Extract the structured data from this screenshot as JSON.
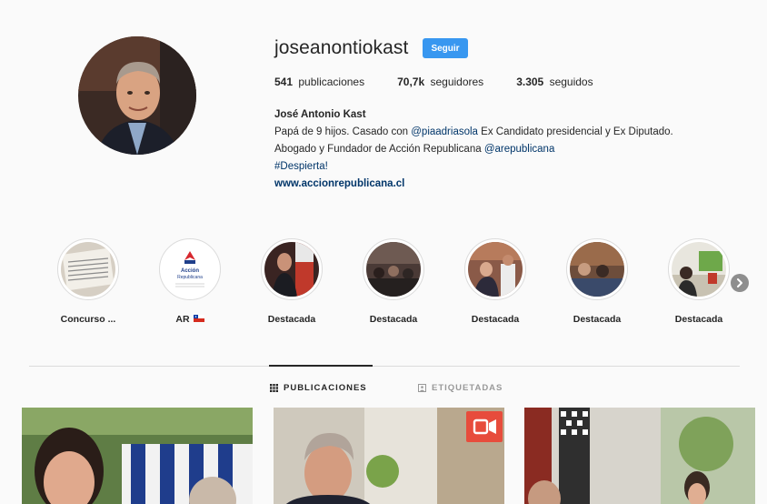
{
  "profile": {
    "username": "joseanontiokast",
    "follow_label": "Seguir",
    "stats": {
      "posts_count": "541",
      "posts_label": "publicaciones",
      "followers_count": "70,7k",
      "followers_label": "seguidores",
      "following_count": "3.305",
      "following_label": "seguidos"
    },
    "full_name": "José Antonio Kast",
    "bio_part1": "Papá de 9 hijos. Casado con ",
    "bio_mention1": "@piaadriasola",
    "bio_part2": " Ex Candidato presidencial y Ex Diputado. Abogado y Fundador de Acción Republicana ",
    "bio_mention2": "@arepublicana",
    "bio_hashtag": "#Despierta!",
    "website": "www.accionrepublicana.cl"
  },
  "highlights": [
    {
      "label": "Concurso ...",
      "thumb": "document-thumbnail"
    },
    {
      "label": "AR",
      "thumb": "accion-republicana-logo",
      "flag": "chile-flag-icon"
    },
    {
      "label": "Destacada",
      "thumb": "speaker-flag-photo"
    },
    {
      "label": "Destacada",
      "thumb": "audience-photo"
    },
    {
      "label": "Destacada",
      "thumb": "meeting-photo"
    },
    {
      "label": "Destacada",
      "thumb": "crowd-photo"
    },
    {
      "label": "Destacada",
      "thumb": "indoor-photo"
    }
  ],
  "tabs": {
    "posts_label": "PUBLICACIONES",
    "tagged_label": "ETIQUETADAS"
  },
  "logo_text": {
    "line1": "Acción",
    "line2": "Republicana"
  },
  "colors": {
    "follow_button": "#3897f0",
    "link": "#003569",
    "video_badge": "#e74c3c"
  }
}
